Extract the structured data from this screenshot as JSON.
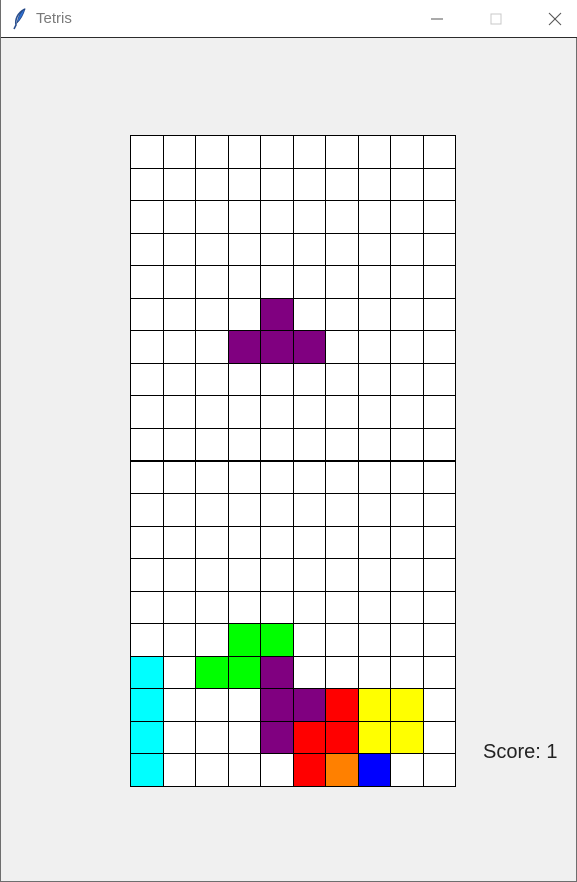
{
  "window": {
    "title": "Tetris",
    "icon": "feather-icon",
    "controls": [
      "minimize-icon",
      "maximize-icon",
      "close-icon"
    ]
  },
  "game": {
    "columns": 10,
    "rows": 20,
    "grid_color": "#000000",
    "empty_color": "#ffffff",
    "cells": [
      {
        "row": 5,
        "col": 4,
        "color": "#800080"
      },
      {
        "row": 6,
        "col": 3,
        "color": "#800080"
      },
      {
        "row": 6,
        "col": 4,
        "color": "#800080"
      },
      {
        "row": 6,
        "col": 5,
        "color": "#800080"
      },
      {
        "row": 15,
        "col": 3,
        "color": "#00ff00"
      },
      {
        "row": 15,
        "col": 4,
        "color": "#00ff00"
      },
      {
        "row": 16,
        "col": 0,
        "color": "#00ffff"
      },
      {
        "row": 16,
        "col": 2,
        "color": "#00ff00"
      },
      {
        "row": 16,
        "col": 3,
        "color": "#00ff00"
      },
      {
        "row": 16,
        "col": 4,
        "color": "#800080"
      },
      {
        "row": 17,
        "col": 0,
        "color": "#00ffff"
      },
      {
        "row": 17,
        "col": 4,
        "color": "#800080"
      },
      {
        "row": 17,
        "col": 5,
        "color": "#800080"
      },
      {
        "row": 17,
        "col": 6,
        "color": "#ff0000"
      },
      {
        "row": 17,
        "col": 7,
        "color": "#ffff00"
      },
      {
        "row": 17,
        "col": 8,
        "color": "#ffff00"
      },
      {
        "row": 18,
        "col": 0,
        "color": "#00ffff"
      },
      {
        "row": 18,
        "col": 4,
        "color": "#800080"
      },
      {
        "row": 18,
        "col": 5,
        "color": "#ff0000"
      },
      {
        "row": 18,
        "col": 6,
        "color": "#ff0000"
      },
      {
        "row": 18,
        "col": 7,
        "color": "#ffff00"
      },
      {
        "row": 18,
        "col": 8,
        "color": "#ffff00"
      },
      {
        "row": 19,
        "col": 0,
        "color": "#00ffff"
      },
      {
        "row": 19,
        "col": 5,
        "color": "#ff0000"
      },
      {
        "row": 19,
        "col": 6,
        "color": "#ff8000"
      },
      {
        "row": 19,
        "col": 7,
        "color": "#0000ff"
      }
    ]
  },
  "score": {
    "text": "Score: 1"
  }
}
